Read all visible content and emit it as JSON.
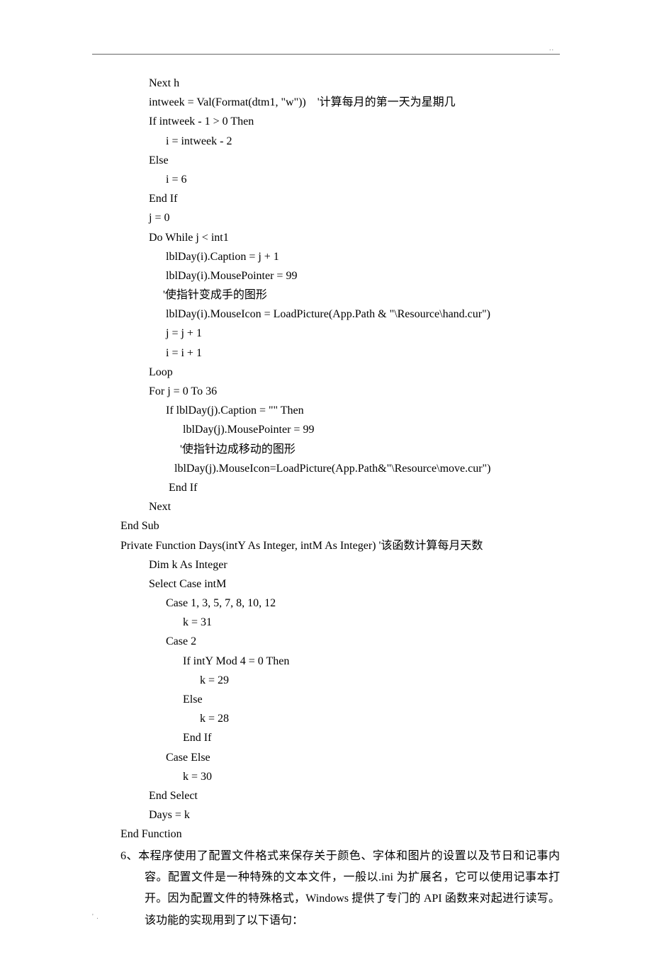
{
  "header": {
    "dots": ".."
  },
  "code": {
    "lines": [
      "          Next h",
      "          intweek = Val(Format(dtm1, \"w\"))    '计算每月的第一天为星期几",
      "          If intweek - 1 > 0 Then",
      "                i = intweek - 2",
      "          Else",
      "                i = 6",
      "          End If",
      "          j = 0",
      "          Do While j < int1",
      "                lblDay(i).Caption = j + 1",
      "                lblDay(i).MousePointer = 99",
      "               '使指针变成手的图形",
      "                lblDay(i).MouseIcon = LoadPicture(App.Path & \"\\Resource\\hand.cur\")",
      "                j = j + 1",
      "                i = i + 1",
      "          Loop",
      "          For j = 0 To 36",
      "                If lblDay(j).Caption = \"\" Then",
      "                      lblDay(j).MousePointer = 99",
      "                     '使指针边成移动的图形",
      "                   lblDay(j).MouseIcon=LoadPicture(App.Path&\"\\Resource\\move.cur\")",
      "                 End If",
      "          Next",
      "End Sub",
      "Private Function Days(intY As Integer, intM As Integer) '该函数计算每月天数",
      "          Dim k As Integer",
      "          Select Case intM",
      "                Case 1, 3, 5, 7, 8, 10, 12",
      "                      k = 31",
      "                Case 2",
      "                      If intY Mod 4 = 0 Then",
      "                            k = 29",
      "                      Else",
      "                            k = 28",
      "                      End If",
      "                Case Else",
      "                      k = 30",
      "          End Select",
      "          Days = k",
      "End Function"
    ]
  },
  "para6": "6、本程序使用了配置文件格式来保存关于颜色、字体和图片的设置以及节日和记事内容。配置文件是一种特殊的文本文件，一般以.ini 为扩展名，它可以使用记事本打开。因为配置文件的特殊格式，Windows 提供了专门的 API 函数来对起进行读写。该功能的实现用到了以下语句：",
  "footer": {
    "mark": "' ."
  }
}
